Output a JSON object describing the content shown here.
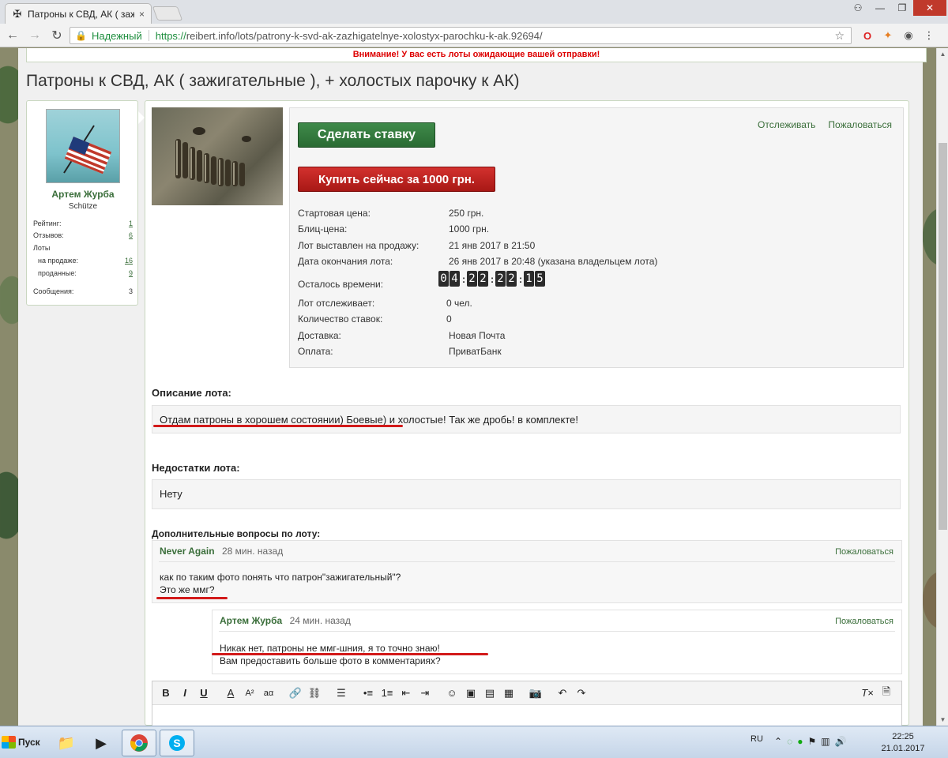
{
  "browser": {
    "tab_title": "Патроны к СВД, АК ( заж",
    "tab_close": "×",
    "omnibox_secure": "Надежный",
    "url_scheme": "https://",
    "url_rest": "reibert.info/lots/patrony-k-svd-ak-zazhigatelnye-xolostyx-parochku-k-ak.92694/",
    "icons": [
      "back-icon",
      "forward-icon",
      "reload-icon",
      "lock-icon",
      "star-icon"
    ]
  },
  "notice": "Внимание! У вас есть лоты ожидающие вашей отправки!",
  "page_title": "Патроны к СВД, АК ( зажигательные ), + холостых парочку к АК)",
  "profile": {
    "name": "Артем Журба",
    "rank": "Schütze",
    "stats": [
      {
        "label": "Рейтинг:",
        "value": "1"
      },
      {
        "label": "Отзывов:",
        "value": "6"
      },
      {
        "label": "Лоты",
        "value": ""
      },
      {
        "label": "на продаже:",
        "value": "16"
      },
      {
        "label": "проданные:",
        "value": "9"
      },
      {
        "label": "Сообщения:",
        "value": "3"
      }
    ]
  },
  "lot": {
    "bid_button": "Сделать ставку",
    "buy_button": "Купить сейчас за 1000 грн.",
    "watch_link": "Отслеживать",
    "report_link": "Пожаловаться",
    "details": [
      {
        "label": "Стартовая цена:",
        "value": "250 грн."
      },
      {
        "label": "Блиц-цена:",
        "value": "1000 грн."
      },
      {
        "label": "Лот выставлен на продажу:",
        "value": "21 янв 2017 в 21:50"
      },
      {
        "label": "Дата окончания лота:",
        "value": "26 янв 2017 в 20:48 (указана владельцем лота)"
      },
      {
        "label": "Осталось времени:",
        "value": ""
      },
      {
        "label": "Лот отслеживает:",
        "value": "0 чел."
      },
      {
        "label": "Количество ставок:",
        "value": "0"
      },
      {
        "label": "Доставка:",
        "value": "Новая Почта"
      },
      {
        "label": "Оплата:",
        "value": "ПриватБанк"
      }
    ],
    "timer": {
      "days": [
        "0",
        "4"
      ],
      "hours": [
        "2",
        "2"
      ],
      "minutes": [
        "2",
        "2"
      ],
      "seconds": [
        "1",
        "5"
      ],
      "sep": ":"
    }
  },
  "description": {
    "heading": "Описание лота:",
    "text": "Отдам патроны в хорошем состоянии) Боевые) и холостые! Так же дробь! в комплекте!"
  },
  "flaws": {
    "heading": "Недостатки лота:",
    "text": "Нету"
  },
  "questions": {
    "heading": "Дополнительные вопросы по лоту:",
    "items": [
      {
        "author": "Never Again",
        "time": "28 мин. назад",
        "report": "Пожаловаться",
        "lines": [
          "как по таким фото понять что патрон\"зажигательный\"?",
          "Это же ммг?"
        ]
      },
      {
        "author": "Артем Журба",
        "time": "24 мин. назад",
        "report": "Пожаловаться",
        "lines": [
          "Никак нет, патроны не ммг-шния, я то точно знаю!",
          "Вам предоставить больше фото в комментариях?"
        ]
      }
    ]
  },
  "editor": {
    "tools": [
      "B",
      "I",
      "U",
      "A",
      "A²",
      "aα",
      "link-icon",
      "unlink-icon",
      "align-icon",
      "bullets-icon",
      "numbers-icon",
      "outdent-icon",
      "indent-icon",
      "smiley-icon",
      "image-icon",
      "media-icon",
      "code-icon",
      "camera-icon",
      "undo-icon",
      "redo-icon",
      "clear-format-icon",
      "draft-icon"
    ]
  },
  "taskbar": {
    "start_label": "Пуск",
    "lang": "RU",
    "time": "22:25",
    "date": "21.01.2017"
  },
  "colors": {
    "accent_green": "#3a6e3a",
    "buy_red": "#c0251f",
    "bid_green": "#2f7a3a",
    "notice_red": "#dd0000",
    "underline_red": "#d21a1a"
  }
}
